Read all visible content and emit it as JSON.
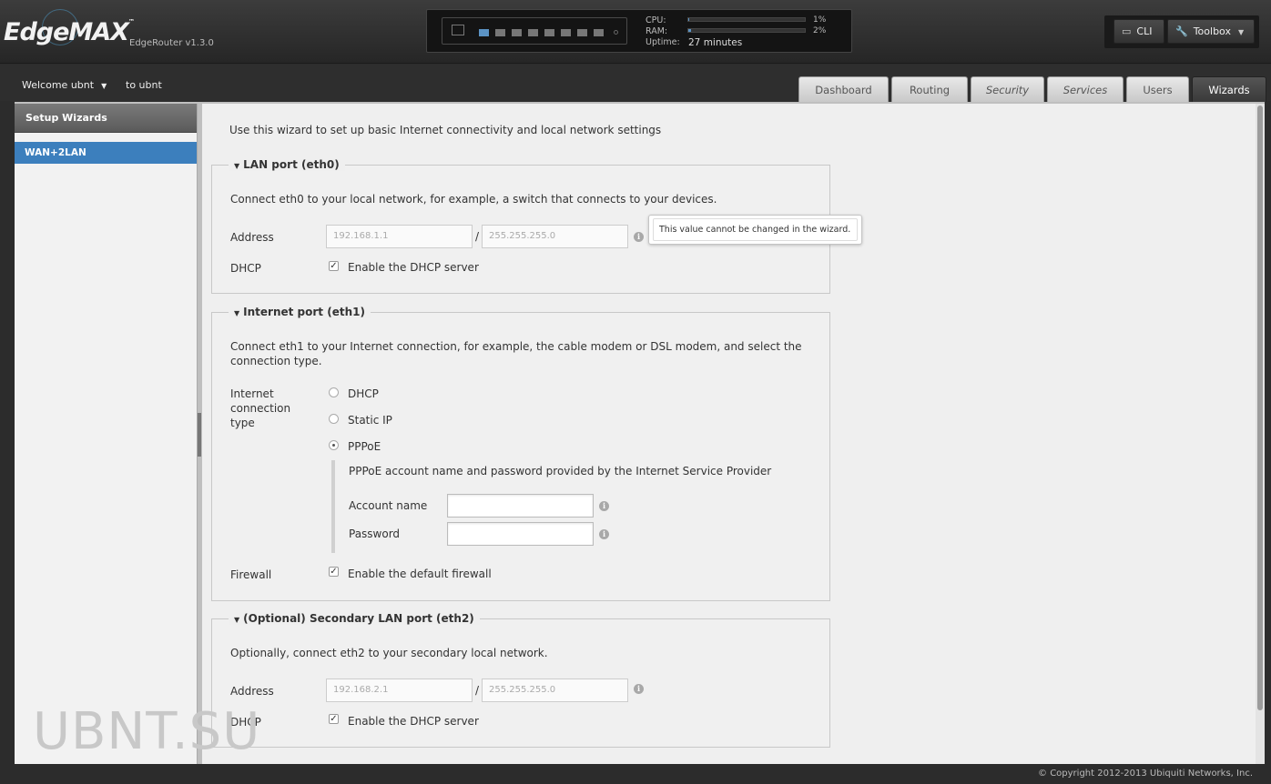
{
  "brand": {
    "logo": "EdgeMAX",
    "tm": "™",
    "version": "EdgeRouter v1.3.0"
  },
  "status": {
    "cpu_label": "CPU:",
    "cpu_value": "1%",
    "cpu_fraction": 0.01,
    "ram_label": "RAM:",
    "ram_value": "2%",
    "ram_fraction": 0.02,
    "uptime_label": "Uptime:",
    "uptime_value": "27 minutes"
  },
  "toolbar": {
    "cli_label": "CLI",
    "toolbox_label": "Toolbox"
  },
  "user": {
    "welcome": "Welcome ubnt",
    "to": "to ubnt"
  },
  "tabs": [
    {
      "label": "Dashboard"
    },
    {
      "label": "Routing"
    },
    {
      "label": "Security"
    },
    {
      "label": "Services"
    },
    {
      "label": "Users"
    },
    {
      "label": "Wizards"
    }
  ],
  "sidebar": {
    "title": "Setup Wizards",
    "items": [
      {
        "label": "WAN+2LAN"
      }
    ]
  },
  "wizard": {
    "intro": "Use this wizard to set up basic Internet connectivity and local network settings",
    "lan": {
      "title": "LAN port (eth0)",
      "desc": "Connect eth0 to your local network, for example, a switch that connects to your devices.",
      "address_label": "Address",
      "address_ip": "192.168.1.1",
      "address_mask": "255.255.255.0",
      "slash": "/",
      "dhcp_label": "DHCP",
      "dhcp_option": "Enable the DHCP server",
      "tooltip": "This value cannot be changed in the wizard."
    },
    "internet": {
      "title": "Internet port (eth1)",
      "desc": "Connect eth1 to your Internet connection, for example, the cable modem or DSL modem, and select the connection type.",
      "type_label": "Internet connection type",
      "options": [
        {
          "label": "DHCP",
          "selected": false
        },
        {
          "label": "Static IP",
          "selected": false
        },
        {
          "label": "PPPoE",
          "selected": true
        }
      ],
      "pppoe_desc": "PPPoE account name and password provided by the Internet Service Provider",
      "account_label": "Account name",
      "account_value": "",
      "password_label": "Password",
      "password_value": "",
      "firewall_label": "Firewall",
      "firewall_option": "Enable the default firewall"
    },
    "secondary": {
      "title": "(Optional) Secondary LAN port (eth2)",
      "desc": "Optionally, connect eth2 to your secondary local network.",
      "address_label": "Address",
      "address_ip": "192.168.2.1",
      "address_mask": "255.255.255.0",
      "slash": "/",
      "dhcp_label": "DHCP",
      "dhcp_option": "Enable the DHCP server"
    }
  },
  "icons": {
    "info": "info-icon",
    "check": "checkmark-icon",
    "terminal": "terminal-icon",
    "wrench": "wrench-icon"
  },
  "watermark": "UBNT.SU",
  "footer": {
    "copyright": "© Copyright 2012-2013 Ubiquiti Networks, Inc."
  },
  "colors": {
    "accent": "#3c7fbd",
    "port_active": "#5b93c4"
  }
}
